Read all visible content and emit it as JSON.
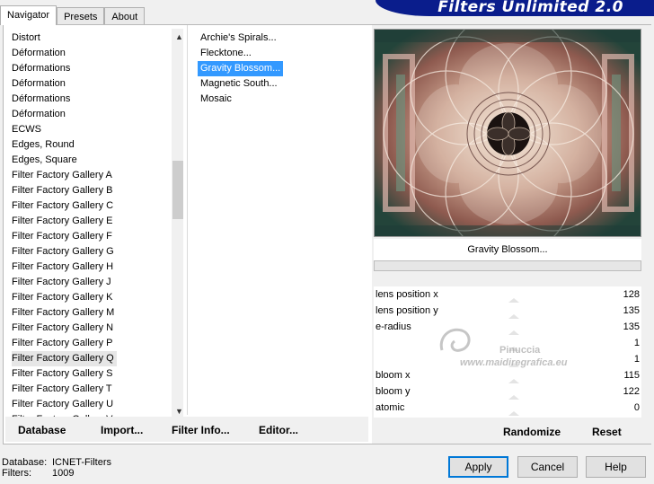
{
  "tabs": [
    "Navigator",
    "Presets",
    "About"
  ],
  "banner": "Filters Unlimited 2.0",
  "categories": [
    "Distort",
    "Déformation",
    "Déformations",
    "Déformation",
    "Déformations",
    "Déformation",
    "ECWS",
    "Edges, Round",
    "Edges, Square",
    "Filter Factory Gallery A",
    "Filter Factory Gallery B",
    "Filter Factory Gallery C",
    "Filter Factory Gallery E",
    "Filter Factory Gallery F",
    "Filter Factory Gallery G",
    "Filter Factory Gallery H",
    "Filter Factory Gallery J",
    "Filter Factory Gallery K",
    "Filter Factory Gallery M",
    "Filter Factory Gallery N",
    "Filter Factory Gallery P",
    "Filter Factory Gallery Q",
    "Filter Factory Gallery S",
    "Filter Factory Gallery T",
    "Filter Factory Gallery U",
    "Filter Factory Gallery V"
  ],
  "selected_category": "Filter Factory Gallery Q",
  "filters": [
    "Archie's Spirals...",
    "Flecktone...",
    "Gravity Blossom...",
    "Magnetic South...",
    "Mosaic"
  ],
  "selected_filter": "Gravity Blossom...",
  "left_buttons": {
    "database": "Database",
    "import": "Import...",
    "filter_info": "Filter Info...",
    "editor": "Editor..."
  },
  "preview_title": "Gravity Blossom...",
  "progress": 0,
  "params": [
    {
      "label": "lens position x",
      "value": "128"
    },
    {
      "label": "lens position y",
      "value": "135"
    },
    {
      "label": "e-radius",
      "value": "135"
    },
    {
      "label": "",
      "value": "1"
    },
    {
      "label": "",
      "value": "1"
    },
    {
      "label": "bloom x",
      "value": "115"
    },
    {
      "label": "bloom y",
      "value": "122"
    },
    {
      "label": "atomic",
      "value": "0"
    }
  ],
  "right_buttons": {
    "randomize": "Randomize",
    "reset": "Reset"
  },
  "watermark": {
    "name": "Pinuccia",
    "url": "www.maidiregrafica.eu"
  },
  "footer": {
    "database_label": "Database:",
    "database_value": "ICNET-Filters",
    "filters_label": "Filters:",
    "filters_value": "1009"
  },
  "dialog_buttons": {
    "apply": "Apply",
    "cancel": "Cancel",
    "help": "Help"
  },
  "colors": {
    "banner": "#0a1d8c",
    "selection": "#3399ff"
  }
}
